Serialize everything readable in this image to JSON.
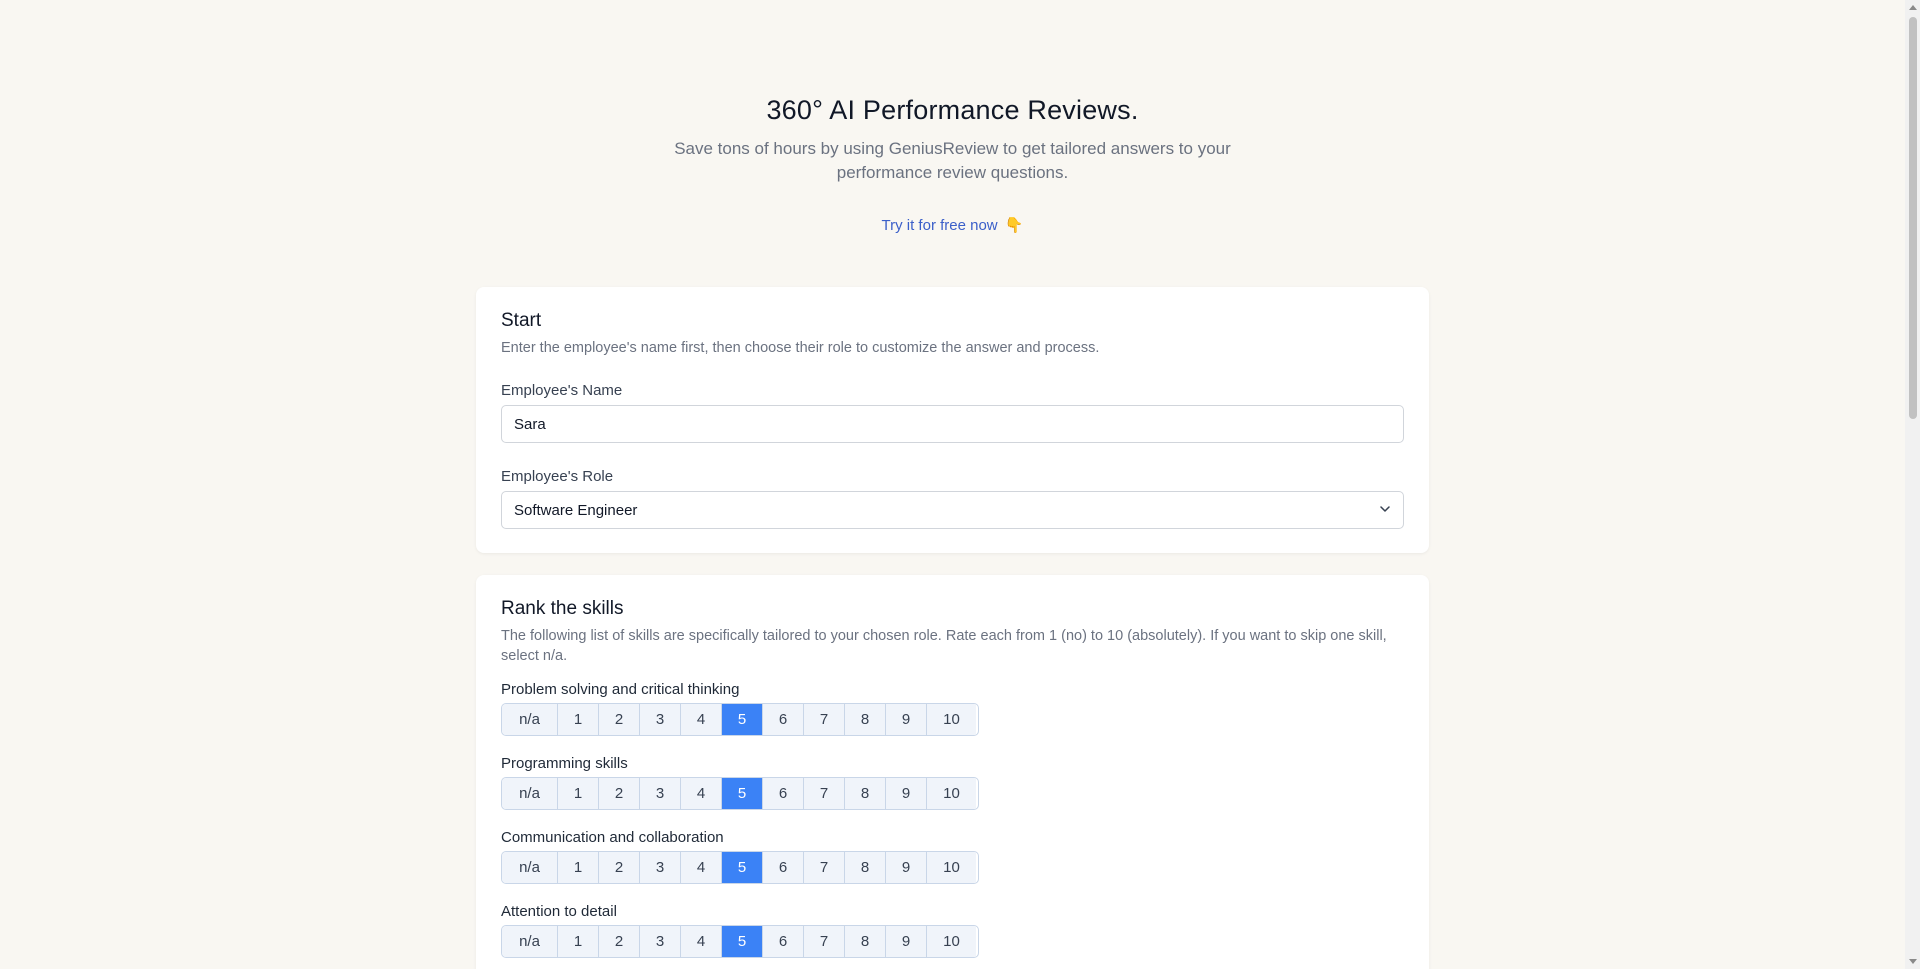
{
  "hero": {
    "title": "360° AI Performance Reviews.",
    "subtitle": "Save tons of hours by using GeniusReview to get tailored answers to your performance review questions.",
    "cta_label": "Try it for free now",
    "cta_emoji": "👇"
  },
  "start": {
    "title": "Start",
    "description": "Enter the employee's name first, then choose their role to customize the answer and process.",
    "name_label": "Employee's Name",
    "name_value": "Sara",
    "role_label": "Employee's Role",
    "role_value": "Software Engineer"
  },
  "skills": {
    "title": "Rank the skills",
    "description": "The following list of skills are specifically tailored to your chosen role. Rate each from 1 (no) to 10 (absolutely). If you want to skip one skill, select n/a.",
    "options": [
      "n/a",
      "1",
      "2",
      "3",
      "4",
      "5",
      "6",
      "7",
      "8",
      "9",
      "10"
    ],
    "items": [
      {
        "label": "Problem solving and critical thinking",
        "selected": "5"
      },
      {
        "label": "Programming skills",
        "selected": "5"
      },
      {
        "label": "Communication and collaboration",
        "selected": "5"
      },
      {
        "label": "Attention to detail",
        "selected": "5"
      }
    ]
  },
  "colors": {
    "background": "#f9f7f2",
    "accent": "#3b82f6",
    "link": "#3b5fc9"
  }
}
